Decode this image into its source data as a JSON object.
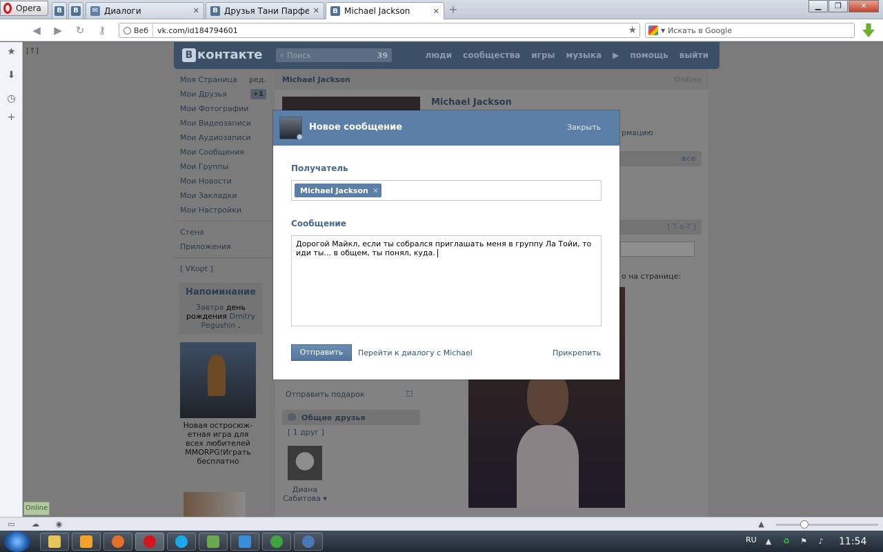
{
  "browser": {
    "menu_label": "Opera",
    "tabs": [
      {
        "favicon": "В",
        "title": ""
      },
      {
        "favicon": "В",
        "title": ""
      },
      {
        "favicon": "msg",
        "title": "Диалоги"
      },
      {
        "favicon": "В",
        "title": "Друзья Тани Парфено..."
      },
      {
        "favicon": "В",
        "title": "Michael Jackson"
      }
    ],
    "address": {
      "security_label": "Веб",
      "url": "vk.com/id184794601"
    },
    "search_placeholder": "Искать в Google",
    "back_to_top": "[↑]",
    "online_tag": "Online"
  },
  "vk": {
    "logo_text": "контакте",
    "search_placeholder": "Поиск",
    "search_count": "39",
    "menu": [
      "люди",
      "сообщества",
      "игры",
      "музыка",
      "помощь",
      "выйти"
    ],
    "left_nav": [
      {
        "label": "Моя Страница",
        "side": "ред."
      },
      {
        "label": "Мои Друзья",
        "badge": "+1"
      },
      {
        "label": "Мои Фотографии"
      },
      {
        "label": "Мои Видеозаписи"
      },
      {
        "label": "Мои Аудиозаписи"
      },
      {
        "label": "Мои Сообщения"
      },
      {
        "label": "Мои Группы"
      },
      {
        "label": "Мои Новости"
      },
      {
        "label": "Мои Закладки"
      },
      {
        "label": "Мои Настройки"
      }
    ],
    "left_nav2": [
      "Стена",
      "Приложения"
    ],
    "vkopt": "[ VKopt ]",
    "reminder": {
      "title": "Напоминание",
      "text_a": "Завтра",
      "text_b": "день рождения",
      "text_c": "Dmitry Pegushin",
      "text_d": "."
    },
    "ad_text": "Новая остросюж-етная игра для всех любителей MMORPG!Играть бесплатно",
    "profile": {
      "name_small": "Michael Jackson",
      "status": "Online",
      "name_big": "Michael Jackson",
      "info_frag": "рмацию",
      "all_link": "все",
      "tat_link": "[ T-a-T ]",
      "page_frag": "о на странице:",
      "gift": "Отправить подарок",
      "mutual_title": "Общие друзья",
      "mutual_count": "[ 1 друг ]",
      "friend_name": "Диана Сабитова ▾"
    }
  },
  "modal": {
    "title": "Новое сообщение",
    "close": "Закрыть",
    "recipient_label": "Получатель",
    "recipient_chip": "Michael Jackson",
    "chip_remove": "✕",
    "message_label": "Сообщение",
    "message_text": "Дорогой Майкл, если ты собрался приглашать меня в группу Ла Тойи, то иди ты... в общем, ты понял, куда.",
    "send": "Отправить",
    "go_dialog": "Перейти к диалогу с Michael",
    "attach": "Прикрепить"
  },
  "taskbar": {
    "lang": "RU",
    "clock": "11:54",
    "apps": [
      "explorer",
      "media",
      "firefox",
      "opera",
      "skype",
      "torrent",
      "keepass",
      "utorrent",
      "opera-mail"
    ]
  }
}
